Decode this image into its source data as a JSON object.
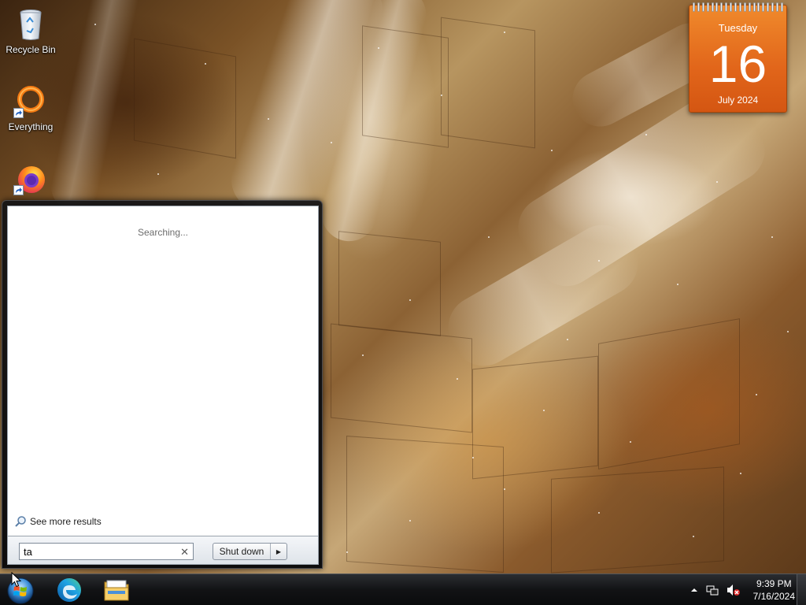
{
  "desktop": {
    "icons": [
      {
        "label": "Recycle Bin",
        "icon": "recycle-bin-icon"
      },
      {
        "label": "Everything",
        "icon": "everything-icon"
      },
      {
        "label": "",
        "icon": "firefox-icon"
      }
    ]
  },
  "calendar": {
    "weekday": "Tuesday",
    "day": "16",
    "month_year": "July 2024",
    "color": "#e56b1f"
  },
  "start_menu": {
    "status": "Searching...",
    "see_more": "See more results",
    "search": {
      "value": "ta",
      "placeholder": ""
    },
    "clear_icon": "close-icon",
    "shutdown_label": "Shut down",
    "shutdown_arrow_icon": "chevron-right-icon"
  },
  "taskbar": {
    "pinned": [
      {
        "name": "edge",
        "icon": "edge-icon"
      },
      {
        "name": "file-explorer",
        "icon": "folder-icon"
      }
    ],
    "tray": {
      "icons": [
        "show-hidden-icons-arrow",
        "network-icon",
        "volume-muted-icon"
      ],
      "time": "9:39 PM",
      "date": "7/16/2024"
    }
  }
}
